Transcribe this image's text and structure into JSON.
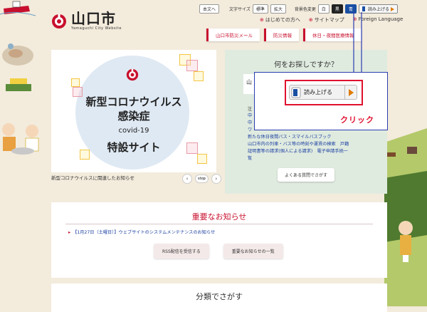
{
  "header": {
    "logo_title": "山口市",
    "logo_subtitle": "Yamaguchi City Website"
  },
  "topbar": {
    "home": "本文へ",
    "font_size_label": "文字サイズ",
    "font_standard": "標準",
    "font_large": "拡大",
    "bg_color_label": "背景色変更",
    "bg_white": "白",
    "bg_black": "黒",
    "bg_blue": "青",
    "read_aloud": "読み上げる"
  },
  "links": {
    "first_time": "はじめての方へ",
    "sitemap": "サイトマップ",
    "foreign": "Foreign Language"
  },
  "red_tabs": [
    "山口市防災メール",
    "防災情報",
    "休日・夜間医療情報"
  ],
  "banner": {
    "line1": "新型コロナウイルス",
    "line2": "感染症",
    "line3": "covid-19",
    "line4": "特設サイト",
    "caption": "新型コロナウイルスに関連したお知らせ",
    "prev": "‹",
    "stop": "stop",
    "next": "›"
  },
  "search": {
    "title": "何をお探しですか？",
    "input_char": "山",
    "note_label": "注",
    "links": [
      "中",
      "中",
      "ワ",
      "新たな休日夜間バス・スマイルバスブック",
      "山口市内の列車・バス等の時刻や運賃の検索　戸籍",
      "証明書等の請求(個人による請求)　電子申請手続一",
      "覧"
    ],
    "faq": "よくある質問でさがす"
  },
  "popup": {
    "button_label": "読み上げる",
    "click_label": "クリック"
  },
  "notice": {
    "title": "重要なお知らせ",
    "item": "【1月27日（土曜日）】ウェブサイトのシステムメンテナンスのお知らせ",
    "rss": "RSS配信を受信する",
    "list": "重要なお知らせの一覧"
  },
  "category": {
    "title": "分類でさがす"
  },
  "colors": {
    "brand_red": "#c8102e",
    "link_blue": "#1a3fa0",
    "popup_border": "#2b3db0",
    "accent_orange": "#e07b00"
  }
}
